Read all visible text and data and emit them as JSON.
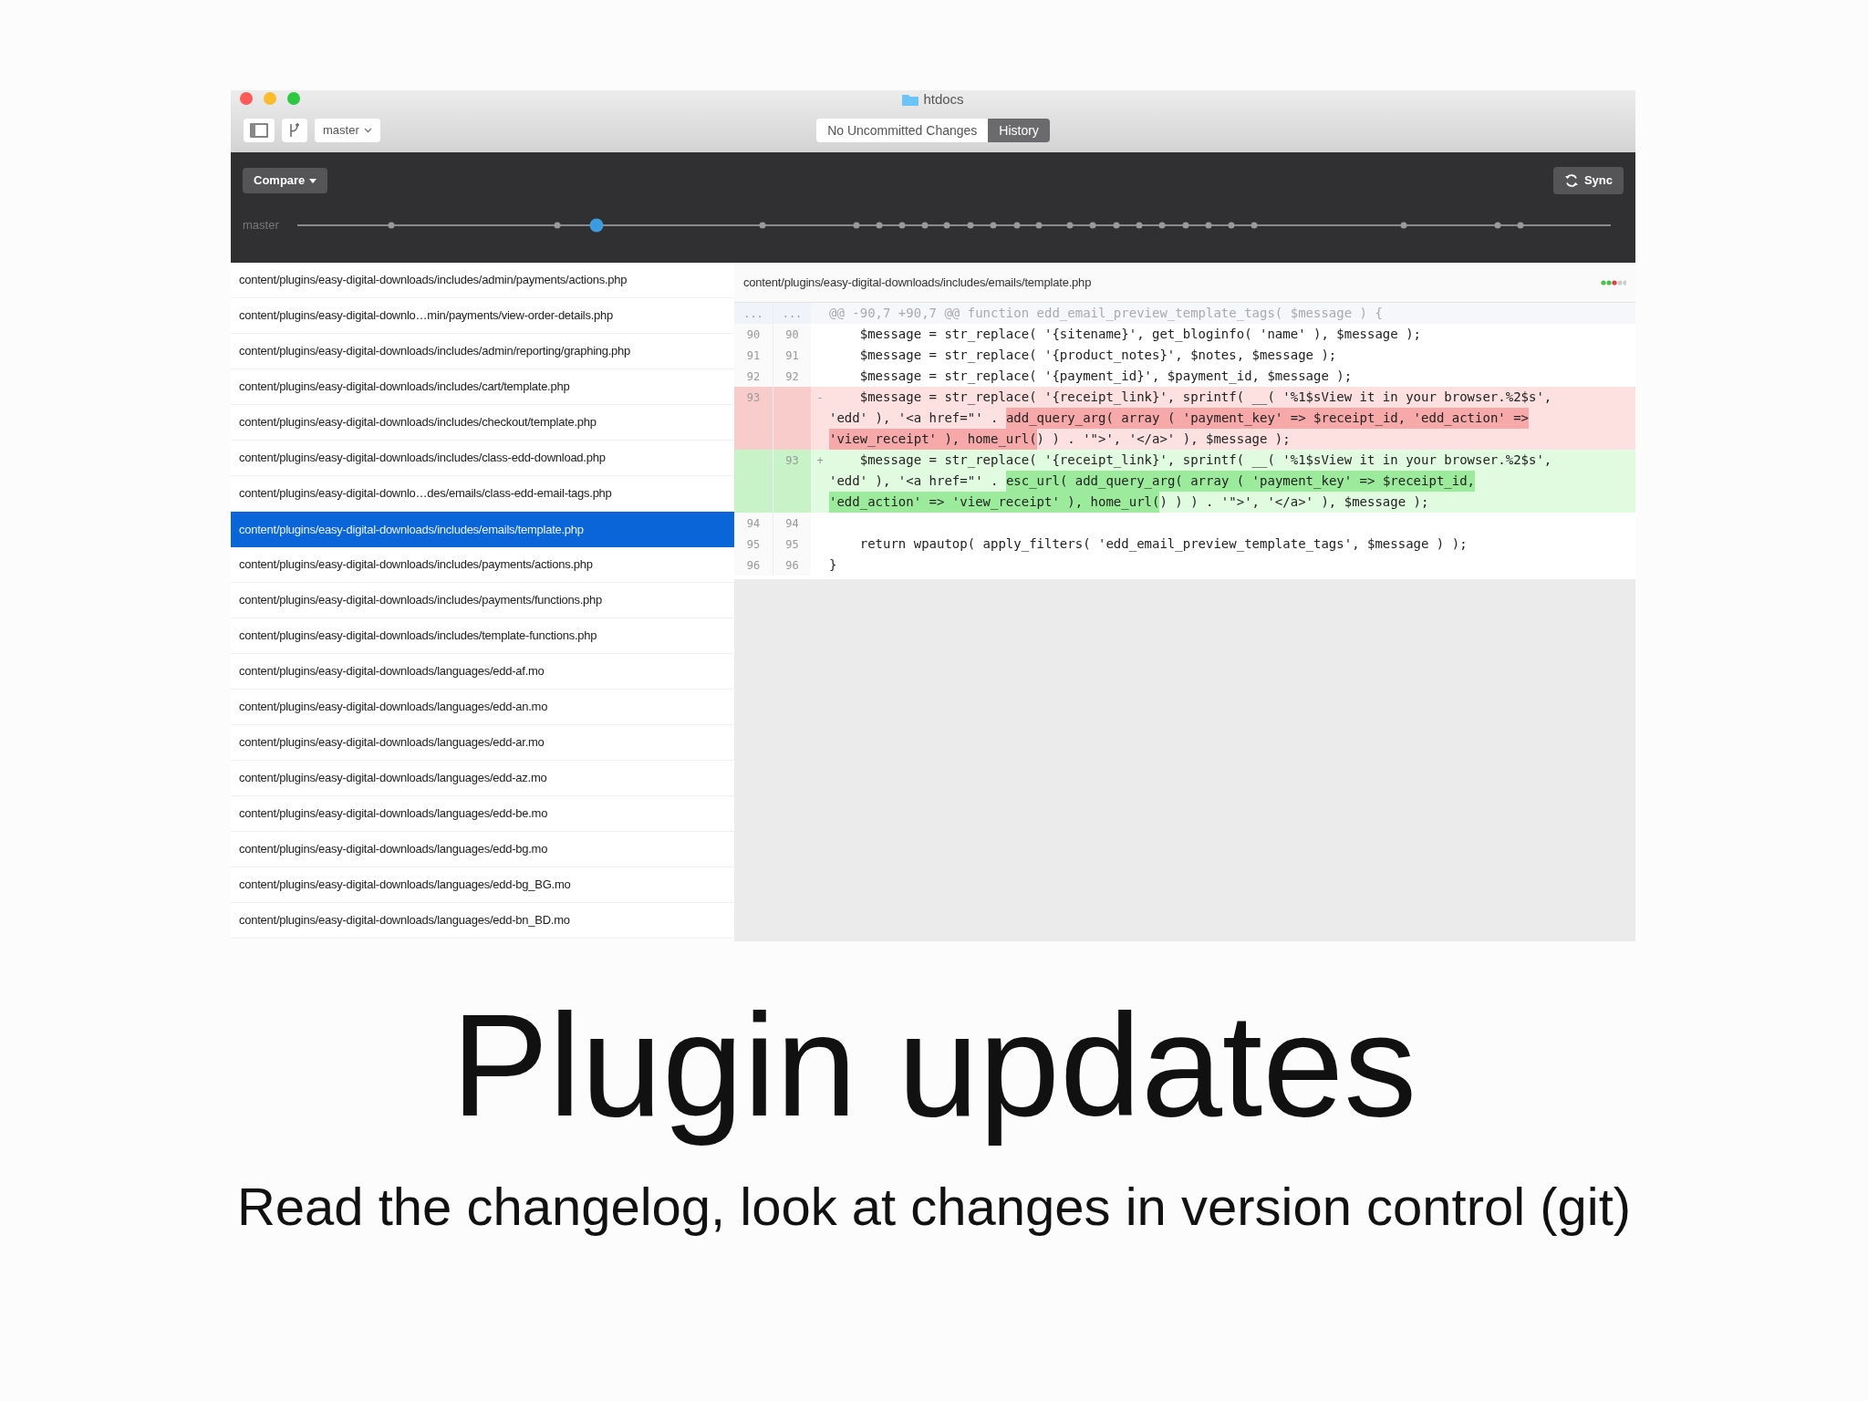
{
  "window": {
    "title": "htdocs"
  },
  "toolbar": {
    "branch": "master",
    "tabs": [
      {
        "label": "No Uncommitted Changes",
        "selected": false
      },
      {
        "label": "History",
        "selected": true
      }
    ]
  },
  "history_bar": {
    "compare": "Compare",
    "sync": "Sync",
    "timeline": {
      "label": "master",
      "commits": [
        {
          "selected": false
        },
        {
          "selected": false
        },
        {
          "selected": true
        },
        {
          "selected": false
        },
        {
          "selected": false
        },
        {
          "selected": false
        },
        {
          "selected": false
        },
        {
          "selected": false
        },
        {
          "selected": false
        },
        {
          "selected": false
        },
        {
          "selected": false
        },
        {
          "selected": false
        },
        {
          "selected": false
        },
        {
          "selected": false
        },
        {
          "selected": false
        },
        {
          "selected": false
        },
        {
          "selected": false
        },
        {
          "selected": false
        },
        {
          "selected": false
        },
        {
          "selected": false
        },
        {
          "selected": false
        },
        {
          "selected": false
        },
        {
          "selected": false
        },
        {
          "selected": false
        },
        {
          "selected": false
        }
      ]
    }
  },
  "files": [
    {
      "path": "content/plugins/easy-digital-downloads/includes/admin/payments/actions.php",
      "selected": false
    },
    {
      "path": "content/plugins/easy-digital-downlo…min/payments/view-order-details.php",
      "selected": false
    },
    {
      "path": "content/plugins/easy-digital-downloads/includes/admin/reporting/graphing.php",
      "selected": false
    },
    {
      "path": "content/plugins/easy-digital-downloads/includes/cart/template.php",
      "selected": false
    },
    {
      "path": "content/plugins/easy-digital-downloads/includes/checkout/template.php",
      "selected": false
    },
    {
      "path": "content/plugins/easy-digital-downloads/includes/class-edd-download.php",
      "selected": false
    },
    {
      "path": "content/plugins/easy-digital-downlo…des/emails/class-edd-email-tags.php",
      "selected": false
    },
    {
      "path": "content/plugins/easy-digital-downloads/includes/emails/template.php",
      "selected": true
    },
    {
      "path": "content/plugins/easy-digital-downloads/includes/payments/actions.php",
      "selected": false
    },
    {
      "path": "content/plugins/easy-digital-downloads/includes/payments/functions.php",
      "selected": false
    },
    {
      "path": "content/plugins/easy-digital-downloads/includes/template-functions.php",
      "selected": false
    },
    {
      "path": "content/plugins/easy-digital-downloads/languages/edd-af.mo",
      "selected": false
    },
    {
      "path": "content/plugins/easy-digital-downloads/languages/edd-an.mo",
      "selected": false
    },
    {
      "path": "content/plugins/easy-digital-downloads/languages/edd-ar.mo",
      "selected": false
    },
    {
      "path": "content/plugins/easy-digital-downloads/languages/edd-az.mo",
      "selected": false
    },
    {
      "path": "content/plugins/easy-digital-downloads/languages/edd-be.mo",
      "selected": false
    },
    {
      "path": "content/plugins/easy-digital-downloads/languages/edd-bg.mo",
      "selected": false
    },
    {
      "path": "content/plugins/easy-digital-downloads/languages/edd-bg_BG.mo",
      "selected": false
    },
    {
      "path": "content/plugins/easy-digital-downloads/languages/edd-bn_BD.mo",
      "selected": false
    }
  ],
  "diff": {
    "file": "content/plugins/easy-digital-downloads/includes/emails/template.php",
    "lines": [
      {
        "kind": "hunk",
        "old": "...",
        "new": "...",
        "rows": [
          [
            {
              "text": "@@ -90,7 +90,7 @@ function edd_email_preview_template_tags( $message ) {",
              "emphasized": false
            }
          ]
        ]
      },
      {
        "kind": "context",
        "old": "90",
        "new": "90",
        "rows": [
          [
            {
              "text": "    $message = str_replace( '{sitename}', get_bloginfo( 'name' ), $message );",
              "emphasized": false
            }
          ]
        ]
      },
      {
        "kind": "context",
        "old": "91",
        "new": "91",
        "rows": [
          [
            {
              "text": "    $message = str_replace( '{product_notes}', $notes, $message );",
              "emphasized": false
            }
          ]
        ]
      },
      {
        "kind": "context",
        "old": "92",
        "new": "92",
        "rows": [
          [
            {
              "text": "    $message = str_replace( '{payment_id}', $payment_id, $message );",
              "emphasized": false
            }
          ]
        ]
      },
      {
        "kind": "del",
        "old": "93",
        "sign": "-",
        "rows": [
          [
            {
              "text": "    $message = str_replace( '{receipt_link}', sprintf( __( '%1$sView it in your browser.%2$s',",
              "emphasized": false
            }
          ],
          [
            {
              "text": "'edd' ), '<a href=\"' . ",
              "emphasized": false
            },
            {
              "text": "add_query_arg( array ( 'payment_key' => $receipt_id, 'edd_action' =>",
              "emphasized": true
            }
          ],
          [
            {
              "text": "'view_receipt' ), home_url(",
              "emphasized": true
            },
            {
              "text": ") ) . '\">', '</a>' ), $message );",
              "emphasized": false
            }
          ]
        ]
      },
      {
        "kind": "add",
        "new": "93",
        "sign": "+",
        "rows": [
          [
            {
              "text": "    $message = str_replace( '{receipt_link}', sprintf( __( '%1$sView it in your browser.%2$s',",
              "emphasized": false
            }
          ],
          [
            {
              "text": "'edd' ), '<a href=\"' . ",
              "emphasized": false
            },
            {
              "text": "esc_url( add_query_arg( array ( 'payment_key' => $receipt_id,",
              "emphasized": true
            }
          ],
          [
            {
              "text": "'edd_action' => 'view_receipt' ), home_url(",
              "emphasized": true
            },
            {
              "text": ") ) ) . '\">', '</a>' ), $message );",
              "emphasized": false
            }
          ]
        ]
      },
      {
        "kind": "context",
        "old": "94",
        "new": "94"
      },
      {
        "kind": "context",
        "old": "95",
        "new": "95",
        "rows": [
          [
            {
              "text": "    return wpautop( apply_filters( 'edd_email_preview_template_tags', $message ) );",
              "emphasized": false
            }
          ]
        ]
      },
      {
        "kind": "context",
        "old": "96",
        "new": "96",
        "rows": [
          [
            {
              "text": "}",
              "emphasized": false
            }
          ]
        ]
      }
    ]
  },
  "slide": {
    "title": "Plugin updates",
    "subtitle": "Read the changelog, look at changes in version control (git)"
  }
}
